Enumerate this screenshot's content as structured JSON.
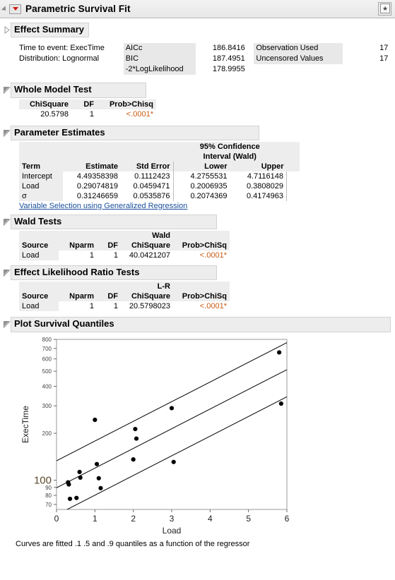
{
  "window": {
    "title": "Parametric Survival Fit",
    "menu_icon": "red-triangle-icon",
    "pin_icon": "window-pin-icon"
  },
  "effect_summary": {
    "label": "Effect Summary",
    "collapsed": true
  },
  "summary": {
    "time_to_event_label": "Time to event: ExecTime",
    "distribution_label": "Distribution: Lognormal",
    "fit_stats": [
      {
        "label": "AICc",
        "value": "186.8416"
      },
      {
        "label": "BIC",
        "value": "187.4951"
      },
      {
        "label": "-2*LogLikelihood",
        "value": "178.9955"
      }
    ],
    "counts": [
      {
        "label": "Observation Used",
        "value": "17"
      },
      {
        "label": "Uncensored Values",
        "value": "17"
      }
    ]
  },
  "whole_model_test": {
    "title": "Whole Model Test",
    "columns": [
      "ChiSquare",
      "DF",
      "Prob>Chisq"
    ],
    "rows": [
      {
        "chisquare": "20.5798",
        "df": "1",
        "prob": "<.0001*"
      }
    ]
  },
  "parameter_estimates": {
    "title": "Parameter Estimates",
    "group_header": "95% Confidence",
    "group_header2": "Interval (Wald)",
    "columns": [
      "Term",
      "Estimate",
      "Std Error",
      "Lower",
      "Upper"
    ],
    "rows": [
      {
        "term": "Intercept",
        "estimate": "4.49358398",
        "std_error": "0.1112423",
        "lower": "4.2755531",
        "upper": "4.7116148"
      },
      {
        "term": "Load",
        "estimate": "0.29074819",
        "std_error": "0.0459471",
        "lower": "0.2006935",
        "upper": "0.3808029"
      },
      {
        "term": "σ",
        "estimate": "0.31246659",
        "std_error": "0.0535876",
        "lower": "0.2074369",
        "upper": "0.4174963"
      }
    ],
    "link_text": "Variable Selection using Generalized Regression"
  },
  "wald_tests": {
    "title": "Wald Tests",
    "group_header": "Wald",
    "columns": [
      "Source",
      "Nparm",
      "DF",
      "ChiSquare",
      "Prob>ChiSq"
    ],
    "rows": [
      {
        "source": "Load",
        "nparm": "1",
        "df": "1",
        "chisquare": "40.0421207",
        "prob": "<.0001*"
      }
    ]
  },
  "effect_lr_tests": {
    "title": "Effect Likelihood Ratio Tests",
    "group_header": "L-R",
    "columns": [
      "Source",
      "Nparm",
      "DF",
      "ChiSquare",
      "Prob>ChiSq"
    ],
    "rows": [
      {
        "source": "Load",
        "nparm": "1",
        "df": "1",
        "chisquare": "20.5798023",
        "prob": "<.0001*"
      }
    ]
  },
  "plot_section": {
    "title": "Plot Survival Quantiles",
    "footnote": "Curves are fitted .1 .5 and .9 quantiles as a function of the regressor"
  },
  "chart_data": {
    "type": "scatter",
    "title": "",
    "xlabel": "Load",
    "ylabel": "ExecTime",
    "xlim": [
      0,
      6
    ],
    "ylim": [
      65,
      800
    ],
    "yscale": "log",
    "xticks": [
      0,
      1,
      2,
      3,
      4,
      5,
      6
    ],
    "yticks": [
      70,
      80,
      90,
      100,
      200,
      300,
      400,
      500,
      600,
      700,
      800
    ],
    "ytick_major": [
      100
    ],
    "grid": false,
    "legend": false,
    "points": [
      {
        "x": 0.3,
        "y": 97
      },
      {
        "x": 0.32,
        "y": 94
      },
      {
        "x": 0.35,
        "y": 76
      },
      {
        "x": 0.52,
        "y": 77
      },
      {
        "x": 0.6,
        "y": 113
      },
      {
        "x": 0.62,
        "y": 104
      },
      {
        "x": 1.0,
        "y": 244
      },
      {
        "x": 1.05,
        "y": 127
      },
      {
        "x": 1.1,
        "y": 103
      },
      {
        "x": 1.15,
        "y": 89
      },
      {
        "x": 2.0,
        "y": 136
      },
      {
        "x": 2.05,
        "y": 213
      },
      {
        "x": 2.08,
        "y": 185
      },
      {
        "x": 3.0,
        "y": 290
      },
      {
        "x": 3.05,
        "y": 131
      },
      {
        "x": 5.8,
        "y": 660
      },
      {
        "x": 5.85,
        "y": 310
      }
    ],
    "curves": [
      {
        "name": "0.9 quantile",
        "intercept": 4.893,
        "slope": 0.2907
      },
      {
        "name": "0.5 quantile",
        "intercept": 4.4936,
        "slope": 0.2907
      },
      {
        "name": "0.1 quantile",
        "intercept": 4.0936,
        "slope": 0.2907
      }
    ]
  }
}
